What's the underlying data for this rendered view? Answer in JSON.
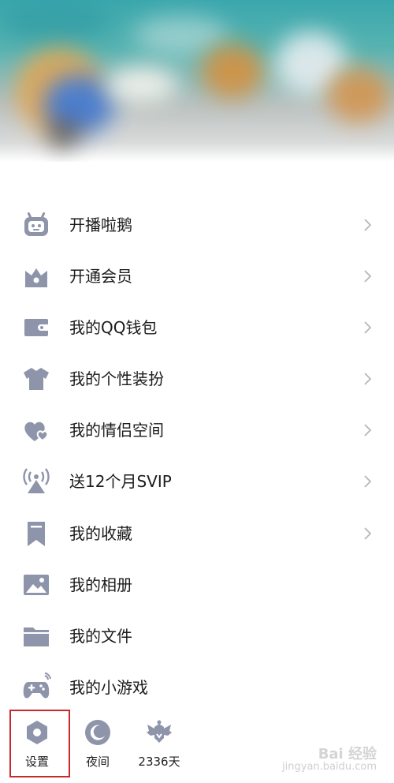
{
  "menu": {
    "items": [
      {
        "label": "开播啦鹅",
        "icon": "tv-robot-icon",
        "chevron": true
      },
      {
        "label": "开通会员",
        "icon": "crown-icon",
        "chevron": true
      },
      {
        "label": "我的QQ钱包",
        "icon": "wallet-icon",
        "chevron": true
      },
      {
        "label": "我的个性装扮",
        "icon": "tshirt-icon",
        "chevron": true
      },
      {
        "label": "我的情侣空间",
        "icon": "couple-hearts-icon",
        "chevron": true
      },
      {
        "label": "送12个月SVIP",
        "icon": "broadcast-tower-icon",
        "chevron": true
      },
      {
        "label": "我的收藏",
        "icon": "bookmark-icon",
        "chevron": true
      },
      {
        "label": "我的相册",
        "icon": "photo-icon",
        "chevron": false
      },
      {
        "label": "我的文件",
        "icon": "folder-icon",
        "chevron": false
      },
      {
        "label": "我的小游戏",
        "icon": "gamepad-icon",
        "chevron": false
      }
    ]
  },
  "bottom": {
    "settings_label": "设置",
    "night_label": "夜间",
    "days_label": "2336天"
  },
  "watermark": {
    "main": "Bai 经验",
    "sub": "jingyan.baidu.com"
  },
  "colors": {
    "icon": "#8e94aa",
    "chevron": "#b7b7b7",
    "highlight": "#c9282d"
  }
}
